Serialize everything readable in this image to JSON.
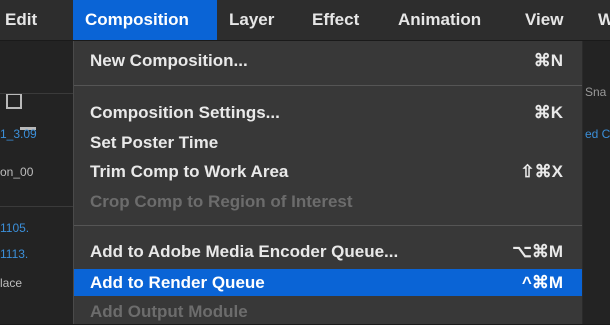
{
  "menubar": {
    "items": [
      {
        "label": "Edit"
      },
      {
        "label": "Composition"
      },
      {
        "label": "Layer"
      },
      {
        "label": "Effect"
      },
      {
        "label": "Animation"
      },
      {
        "label": "View"
      },
      {
        "label": "W"
      }
    ]
  },
  "left_panel": {
    "rows": [
      "1_3.09",
      "on_00",
      "1105.",
      "1113.",
      "lace"
    ]
  },
  "right_panel": {
    "rows": [
      "Sna",
      "ed C"
    ]
  },
  "menu": {
    "items": [
      {
        "label": "New Composition...",
        "shortcut": "⌘N",
        "enabled": true
      },
      {
        "label": "Composition Settings...",
        "shortcut": "⌘K",
        "enabled": true
      },
      {
        "label": "Set Poster Time",
        "shortcut": "",
        "enabled": true
      },
      {
        "label": "Trim Comp to Work Area",
        "shortcut": "⇧⌘X",
        "enabled": true
      },
      {
        "label": "Crop Comp to Region of Interest",
        "shortcut": "",
        "enabled": false
      },
      {
        "label": "Add to Adobe Media Encoder Queue...",
        "shortcut": "⌥⌘M",
        "enabled": true
      },
      {
        "label": "Add to Render Queue",
        "shortcut": "^⌘M",
        "enabled": true,
        "highlighted": true
      },
      {
        "label": "Add Output Module",
        "shortcut": "",
        "enabled": false
      }
    ]
  },
  "colors": {
    "highlight": "#0a64d6",
    "menu_bg": "#383838",
    "menubar_bg": "#2d2d2d",
    "disabled_text": "#6c6c6c",
    "link_blue": "#3b8fd9"
  }
}
